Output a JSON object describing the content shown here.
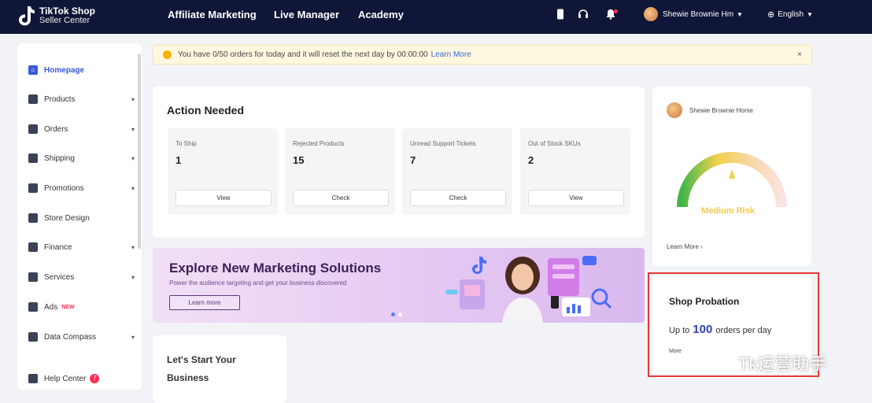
{
  "brand": {
    "line1": "TikTok Shop",
    "line2": "Seller Center"
  },
  "nav": [
    {
      "label": "Affiliate Marketing"
    },
    {
      "label": "Live Manager"
    },
    {
      "label": "Academy"
    }
  ],
  "header": {
    "user_name": "Shewie Brownie Hm",
    "language": "English"
  },
  "sidebar": {
    "items": [
      {
        "label": "Homepage",
        "icon": "home-icon"
      },
      {
        "label": "Products",
        "icon": "box-icon"
      },
      {
        "label": "Orders",
        "icon": "orders-icon"
      },
      {
        "label": "Shipping",
        "icon": "truck-icon"
      },
      {
        "label": "Promotions",
        "icon": "megaphone-icon"
      },
      {
        "label": "Store Design",
        "icon": "store-icon"
      },
      {
        "label": "Finance",
        "icon": "wallet-icon"
      },
      {
        "label": "Services",
        "icon": "services-icon"
      },
      {
        "label": "Ads",
        "icon": "ads-icon",
        "badge": "NEW"
      },
      {
        "label": "Data Compass",
        "icon": "chart-icon"
      },
      {
        "label": "Help Center",
        "icon": "help-icon",
        "badge": "7"
      }
    ]
  },
  "notice": {
    "text": "You have 0/50 orders for today and it will reset the next day by 00:00:00",
    "link": "Learn More",
    "close": "×"
  },
  "action_needed": {
    "title": "Action Needed",
    "tiles": [
      {
        "label": "To Ship",
        "value": "1",
        "button": "View"
      },
      {
        "label": "Rejected Products",
        "value": "15",
        "button": "Check"
      },
      {
        "label": "Unread Support Tickets",
        "value": "7",
        "button": "Check"
      },
      {
        "label": "Out of Stock SKUs",
        "value": "2",
        "button": "View"
      }
    ]
  },
  "banner": {
    "title": "Explore New Marketing Solutions",
    "subtitle": "Power the audience targeting and get your business discovered",
    "button": "Learn more",
    "slides_total": 2,
    "active_slide": 1
  },
  "start": {
    "title": "Let's Start Your Business"
  },
  "health": {
    "shop_name": "Shewie Brownie Home",
    "risk_label": "Medium Risk",
    "learn_more": "Learn More",
    "learn_more_arrow": "›",
    "gauge_level": 0.5
  },
  "probation": {
    "title": "Shop Probation",
    "prefix": "Up to",
    "value": "100",
    "suffix": "orders per day",
    "more": "More"
  },
  "watermark": {
    "text": "Tk运营助手"
  },
  "colors": {
    "nav_bg": "#101637",
    "accent": "#3a5ad6",
    "highlight_frame": "#e53935"
  }
}
